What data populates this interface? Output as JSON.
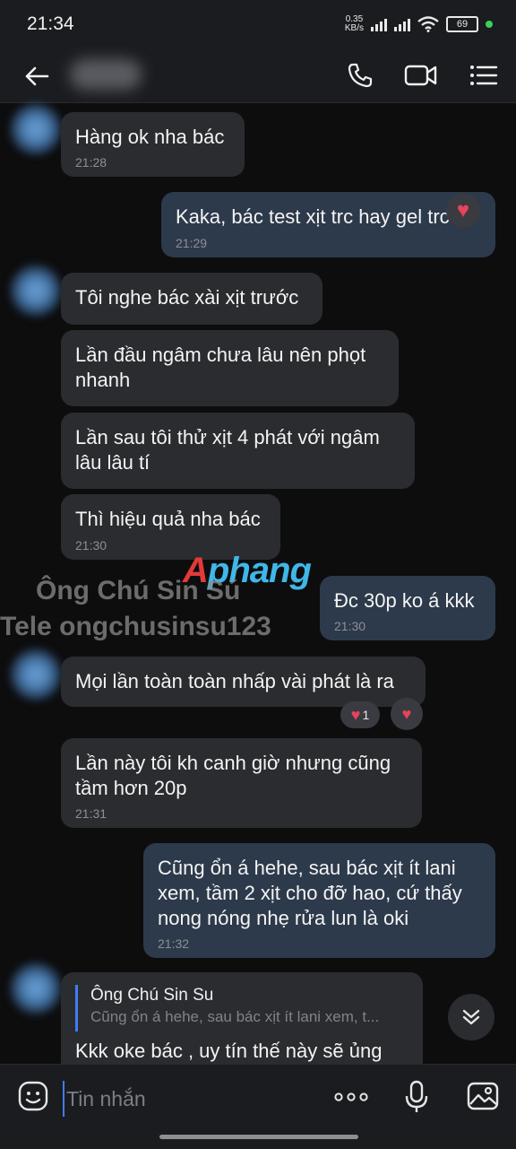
{
  "status": {
    "time": "21:34",
    "net_speed": "0.35",
    "net_unit": "KB/s",
    "battery": "69"
  },
  "header": {
    "back_icon": "arrow-left-icon",
    "call_icon": "phone-icon",
    "video_icon": "video-camera-icon",
    "menu_icon": "list-icon"
  },
  "messages": [
    {
      "dir": "in",
      "text": "Hàng ok nha bác",
      "time": "21:28"
    },
    {
      "dir": "out",
      "text": "Kaka, bác test xịt trc hay gel trc á",
      "time": "21:29"
    },
    {
      "dir": "in",
      "text": "Tôi nghe bác xài xịt trước",
      "time": ""
    },
    {
      "dir": "in",
      "text": "Lần đầu ngâm chưa lâu nên phọt\nnhanh",
      "time": ""
    },
    {
      "dir": "in",
      "text": "Lần sau tôi thử xịt 4 phát với ngâm\nlâu lâu tí",
      "time": ""
    },
    {
      "dir": "in",
      "text": "Thì hiệu quả nha bác",
      "time": "21:30"
    },
    {
      "dir": "out",
      "text": "Đc 30p ko á kkk",
      "time": "21:30"
    },
    {
      "dir": "in",
      "text": "Mọi lần toàn toàn nhấp vài phát là ra",
      "time": ""
    },
    {
      "dir": "in",
      "text": "Lần này tôi kh canh giờ nhưng cũng\ntầm hơn 20p",
      "time": "21:31"
    },
    {
      "dir": "out",
      "text": "Cũng ổn á hehe, sau bác xịt ít lani\nxem, tầm 2 xịt cho đỡ hao, cứ thấy\nnong nóng nhẹ rửa lun là oki",
      "time": "21:32"
    },
    {
      "dir": "in",
      "text": "Kkk oke bác , uy tín thế này sẽ ủng",
      "time": ""
    }
  ],
  "reactions": {
    "heart_count": "1"
  },
  "reply_quote": {
    "name": "Ông Chú Sin Su",
    "text": "Cũng ổn á hehe, sau bác xịt ít lani xem, t..."
  },
  "watermark": {
    "line1": "Ông Chú Sin Sú",
    "line2": "Tele ongchusinsu123",
    "logo": "Aphang"
  },
  "input": {
    "placeholder": "Tin nhắn"
  },
  "colors": {
    "incoming_bubble": "#2b2c30",
    "outgoing_bubble": "#2d3a4b",
    "accent": "#3d7ef5",
    "heart": "#e8435a"
  }
}
